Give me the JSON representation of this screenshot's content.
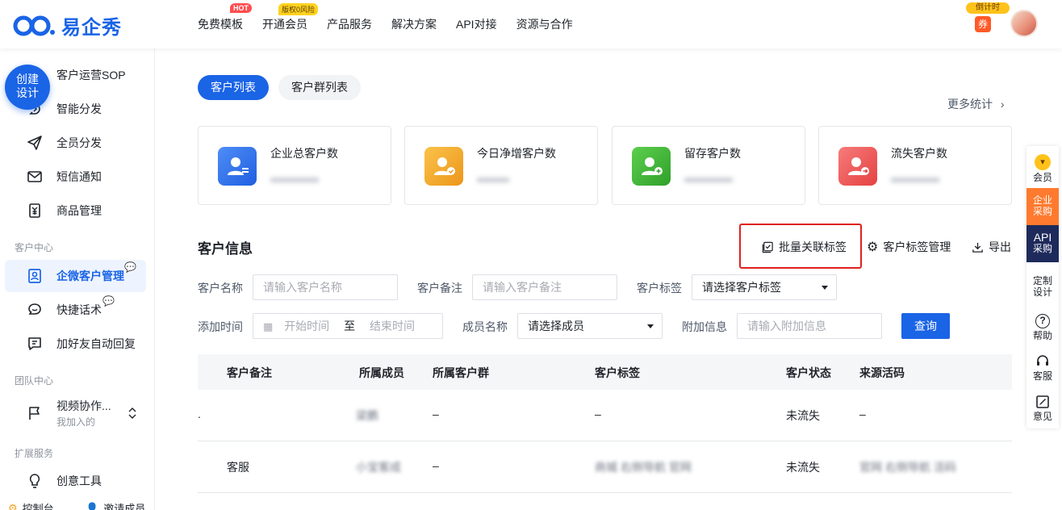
{
  "header": {
    "brand": "易企秀",
    "nav": [
      {
        "label": "免费模板",
        "badge": "HOT"
      },
      {
        "label": "开通会员",
        "badge": "版权0风险"
      },
      {
        "label": "产品服务",
        "badge": ""
      },
      {
        "label": "解决方案",
        "badge": ""
      },
      {
        "label": "API对接",
        "badge": ""
      },
      {
        "label": "资源与合作",
        "badge": ""
      }
    ],
    "countdown": "倒计时",
    "coupon": "券"
  },
  "sidebar": {
    "create_button": [
      "创建",
      "设计"
    ],
    "items": [
      {
        "label": "客户运营SOP",
        "icon": "sop-icon"
      },
      {
        "label": "智能分发",
        "icon": "smart-distribute-icon"
      },
      {
        "label": "全员分发",
        "icon": "paper-plane-icon"
      },
      {
        "label": "短信通知",
        "icon": "mail-icon"
      },
      {
        "label": "商品管理",
        "icon": "product-icon"
      }
    ],
    "group_customer": "客户中心",
    "wecom_customer": "企微客户管理",
    "quick_reply": "快捷话术",
    "auto_reply": "加好友自动回复",
    "group_team": "团队中心",
    "video_collab": "视频协作...",
    "video_collab_sub": "我加入的",
    "group_ext": "扩展服务",
    "creative_tools": "创意工具",
    "bottom_left": "控制台",
    "bottom_right": "邀请成员"
  },
  "main": {
    "tabs": [
      "客户列表",
      "客户群列表"
    ],
    "more_stats": "更多统计",
    "cards": [
      {
        "title": "企业总客户数",
        "color": "#2f6fec"
      },
      {
        "title": "今日净增客户数",
        "color": "#f0a11c"
      },
      {
        "title": "留存客户数",
        "color": "#41b23a"
      },
      {
        "title": "流失客户数",
        "color": "#ef4b4b"
      }
    ],
    "section_title": "客户信息",
    "actions": {
      "batch_tag": "批量关联标签",
      "tag_manage": "客户标签管理",
      "export": "导出"
    },
    "filters": {
      "name_label": "客户名称",
      "name_placeholder": "请输入客户名称",
      "remark_label": "客户备注",
      "remark_placeholder": "请输入客户备注",
      "tag_label": "客户标签",
      "tag_value": "请选择客户标签",
      "time_label": "添加时间",
      "time_start": "开始时间",
      "time_sep": "至",
      "time_end": "结束时间",
      "member_label": "成员名称",
      "member_value": "请选择成员",
      "extra_label": "附加信息",
      "extra_placeholder": "请输入附加信息",
      "query": "查询"
    },
    "table": {
      "headers": [
        "客户备注",
        "所属成员",
        "所属客户群",
        "客户标签",
        "客户状态",
        "来源活码"
      ],
      "rows": [
        {
          "remark": ".",
          "member": "梁鹏",
          "group": "–",
          "tags": "–",
          "status": "未流失",
          "source": "–"
        },
        {
          "remark": "客服",
          "member": "小宝客成",
          "group": "–",
          "tags": "商城 右侧导航 官网",
          "status": "未流失",
          "source": "官网 右侧导航 活码"
        }
      ]
    }
  },
  "rightbar": {
    "vip": "会员",
    "enterprise": [
      "企业",
      "采购"
    ],
    "api": [
      "API",
      "采购"
    ],
    "custom": [
      "定制",
      "设计"
    ],
    "help": "帮助",
    "service": "客服",
    "feedback": "意见"
  }
}
